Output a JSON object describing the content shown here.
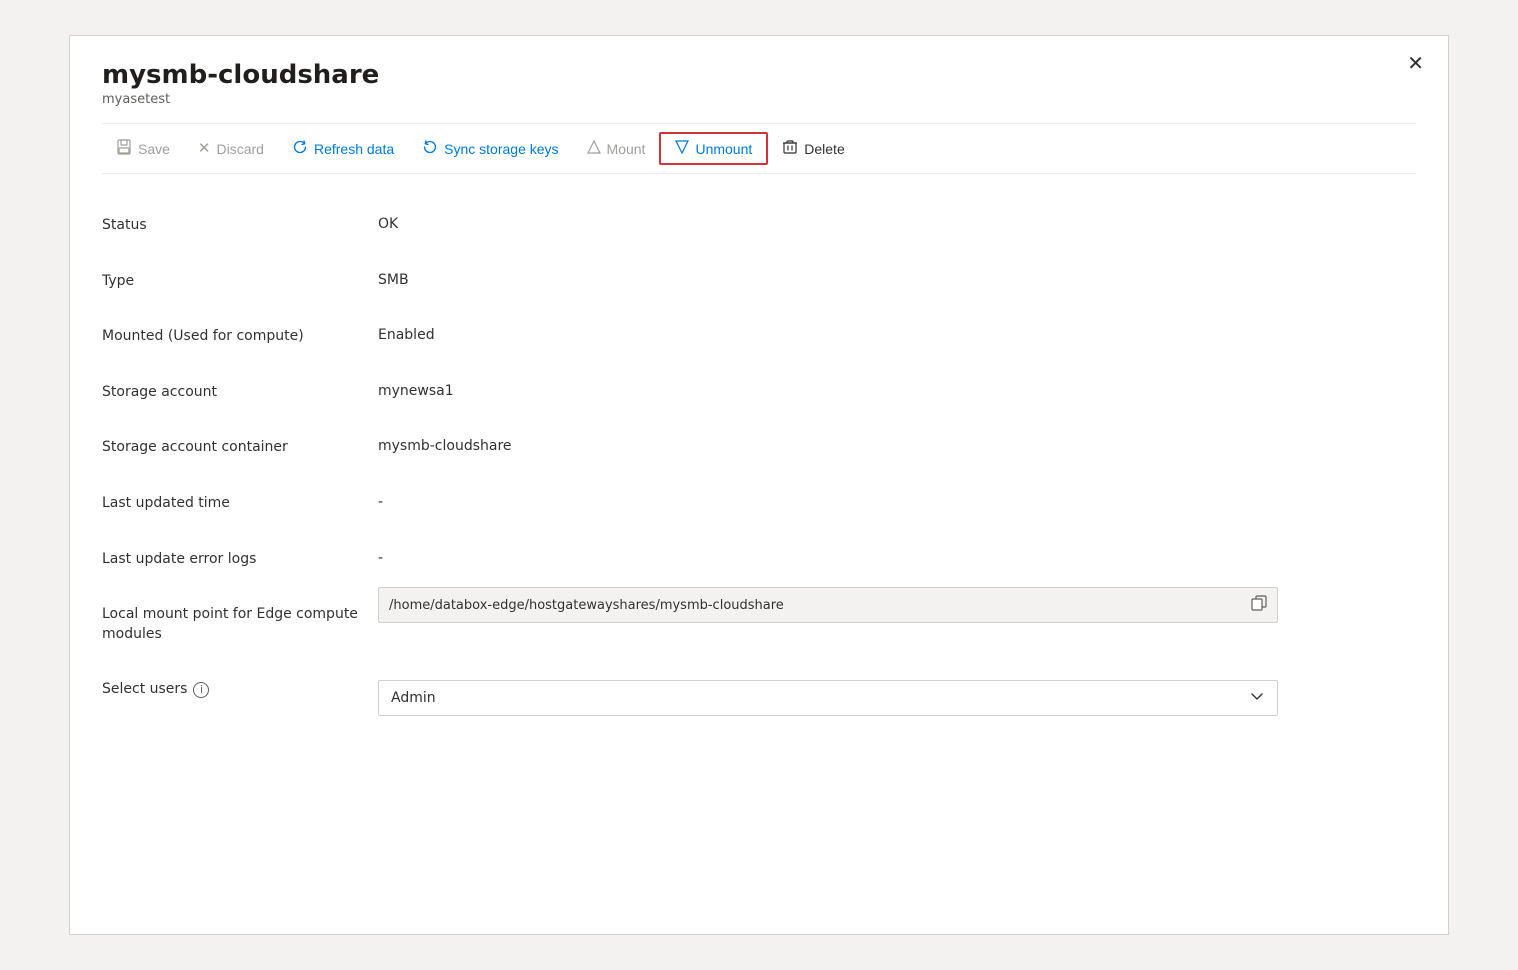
{
  "panel": {
    "title": "mysmb-cloudshare",
    "subtitle": "myasetest",
    "close_label": "✕"
  },
  "toolbar": {
    "save_label": "Save",
    "discard_label": "Discard",
    "refresh_label": "Refresh data",
    "sync_label": "Sync storage keys",
    "mount_label": "Mount",
    "unmount_label": "Unmount",
    "delete_label": "Delete"
  },
  "fields": {
    "status_label": "Status",
    "status_value": "OK",
    "type_label": "Type",
    "type_value": "SMB",
    "mounted_label": "Mounted (Used for compute)",
    "mounted_value": "Enabled",
    "storage_account_label": "Storage account",
    "storage_account_value": "mynewsa1",
    "storage_container_label": "Storage account container",
    "storage_container_value": "mysmb-cloudshare",
    "last_updated_label": "Last updated time",
    "last_updated_value": "-",
    "last_error_label": "Last update error logs",
    "last_error_value": "-",
    "local_mount_label": "Local mount point for Edge compute modules",
    "local_mount_value": "/home/databox-edge/hostgatewayshares/mysmb-cloudshare",
    "select_users_label": "Select users",
    "select_users_value": "Admin"
  },
  "icons": {
    "save": "🖫",
    "discard": "✕",
    "refresh": "↻",
    "sync": "↺",
    "mount": "△",
    "unmount": "▽",
    "delete": "🗑",
    "copy": "⧉",
    "chevron_down": "⌵",
    "info": "i"
  }
}
